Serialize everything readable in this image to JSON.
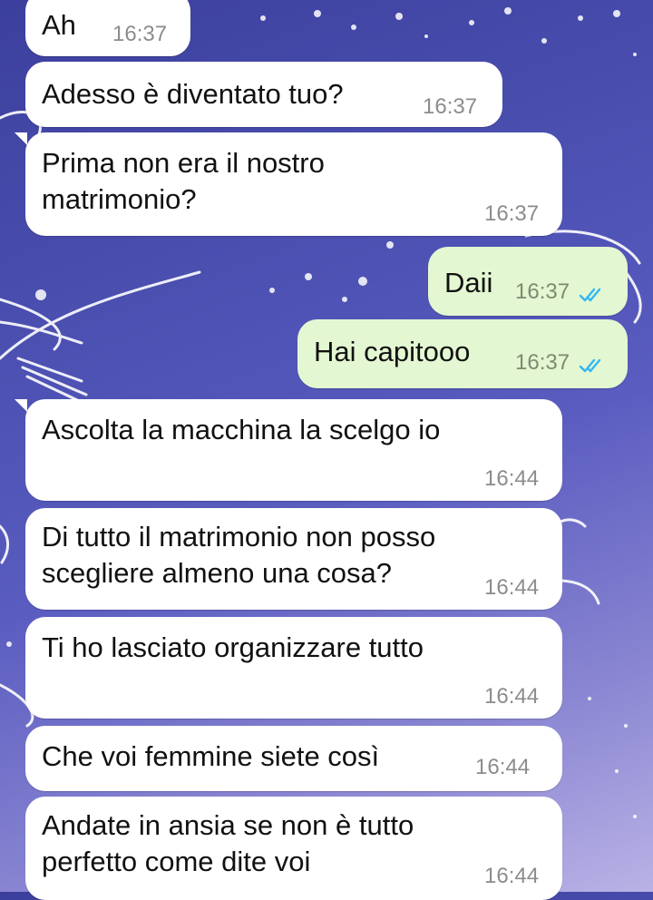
{
  "chat": {
    "messages": [
      {
        "direction": "in",
        "text": "Ah",
        "time": "16:37"
      },
      {
        "direction": "in",
        "text": "Adesso è diventato tuo?",
        "time": "16:37"
      },
      {
        "direction": "in",
        "lines": [
          "Prima non era il nostro",
          "matrimonio?"
        ],
        "time": "16:37"
      },
      {
        "direction": "out",
        "text": "Daii",
        "time": "16:37",
        "status": "read"
      },
      {
        "direction": "out",
        "text": "Hai capitooo",
        "time": "16:37",
        "status": "read"
      },
      {
        "direction": "in",
        "text": "Ascolta la macchina la scelgo io",
        "time": "16:44"
      },
      {
        "direction": "in",
        "lines": [
          "Di tutto il matrimonio non posso",
          "scegliere almeno una cosa?"
        ],
        "time": "16:44"
      },
      {
        "direction": "in",
        "text": "Ti ho lasciato organizzare tutto",
        "time": "16:44"
      },
      {
        "direction": "in",
        "text": "Che voi femmine siete così",
        "time": "16:44"
      },
      {
        "direction": "in",
        "lines": [
          "Andate in ansia se non è tutto",
          "perfetto come dite voi"
        ],
        "time": "16:44"
      }
    ]
  },
  "icons": {
    "read_receipt": "double-check-icon"
  },
  "colors": {
    "incoming_bubble": "#ffffff",
    "outgoing_bubble": "#e3f7d2",
    "read_tick": "#34b7f1",
    "timestamp": "#8c8c8c"
  }
}
